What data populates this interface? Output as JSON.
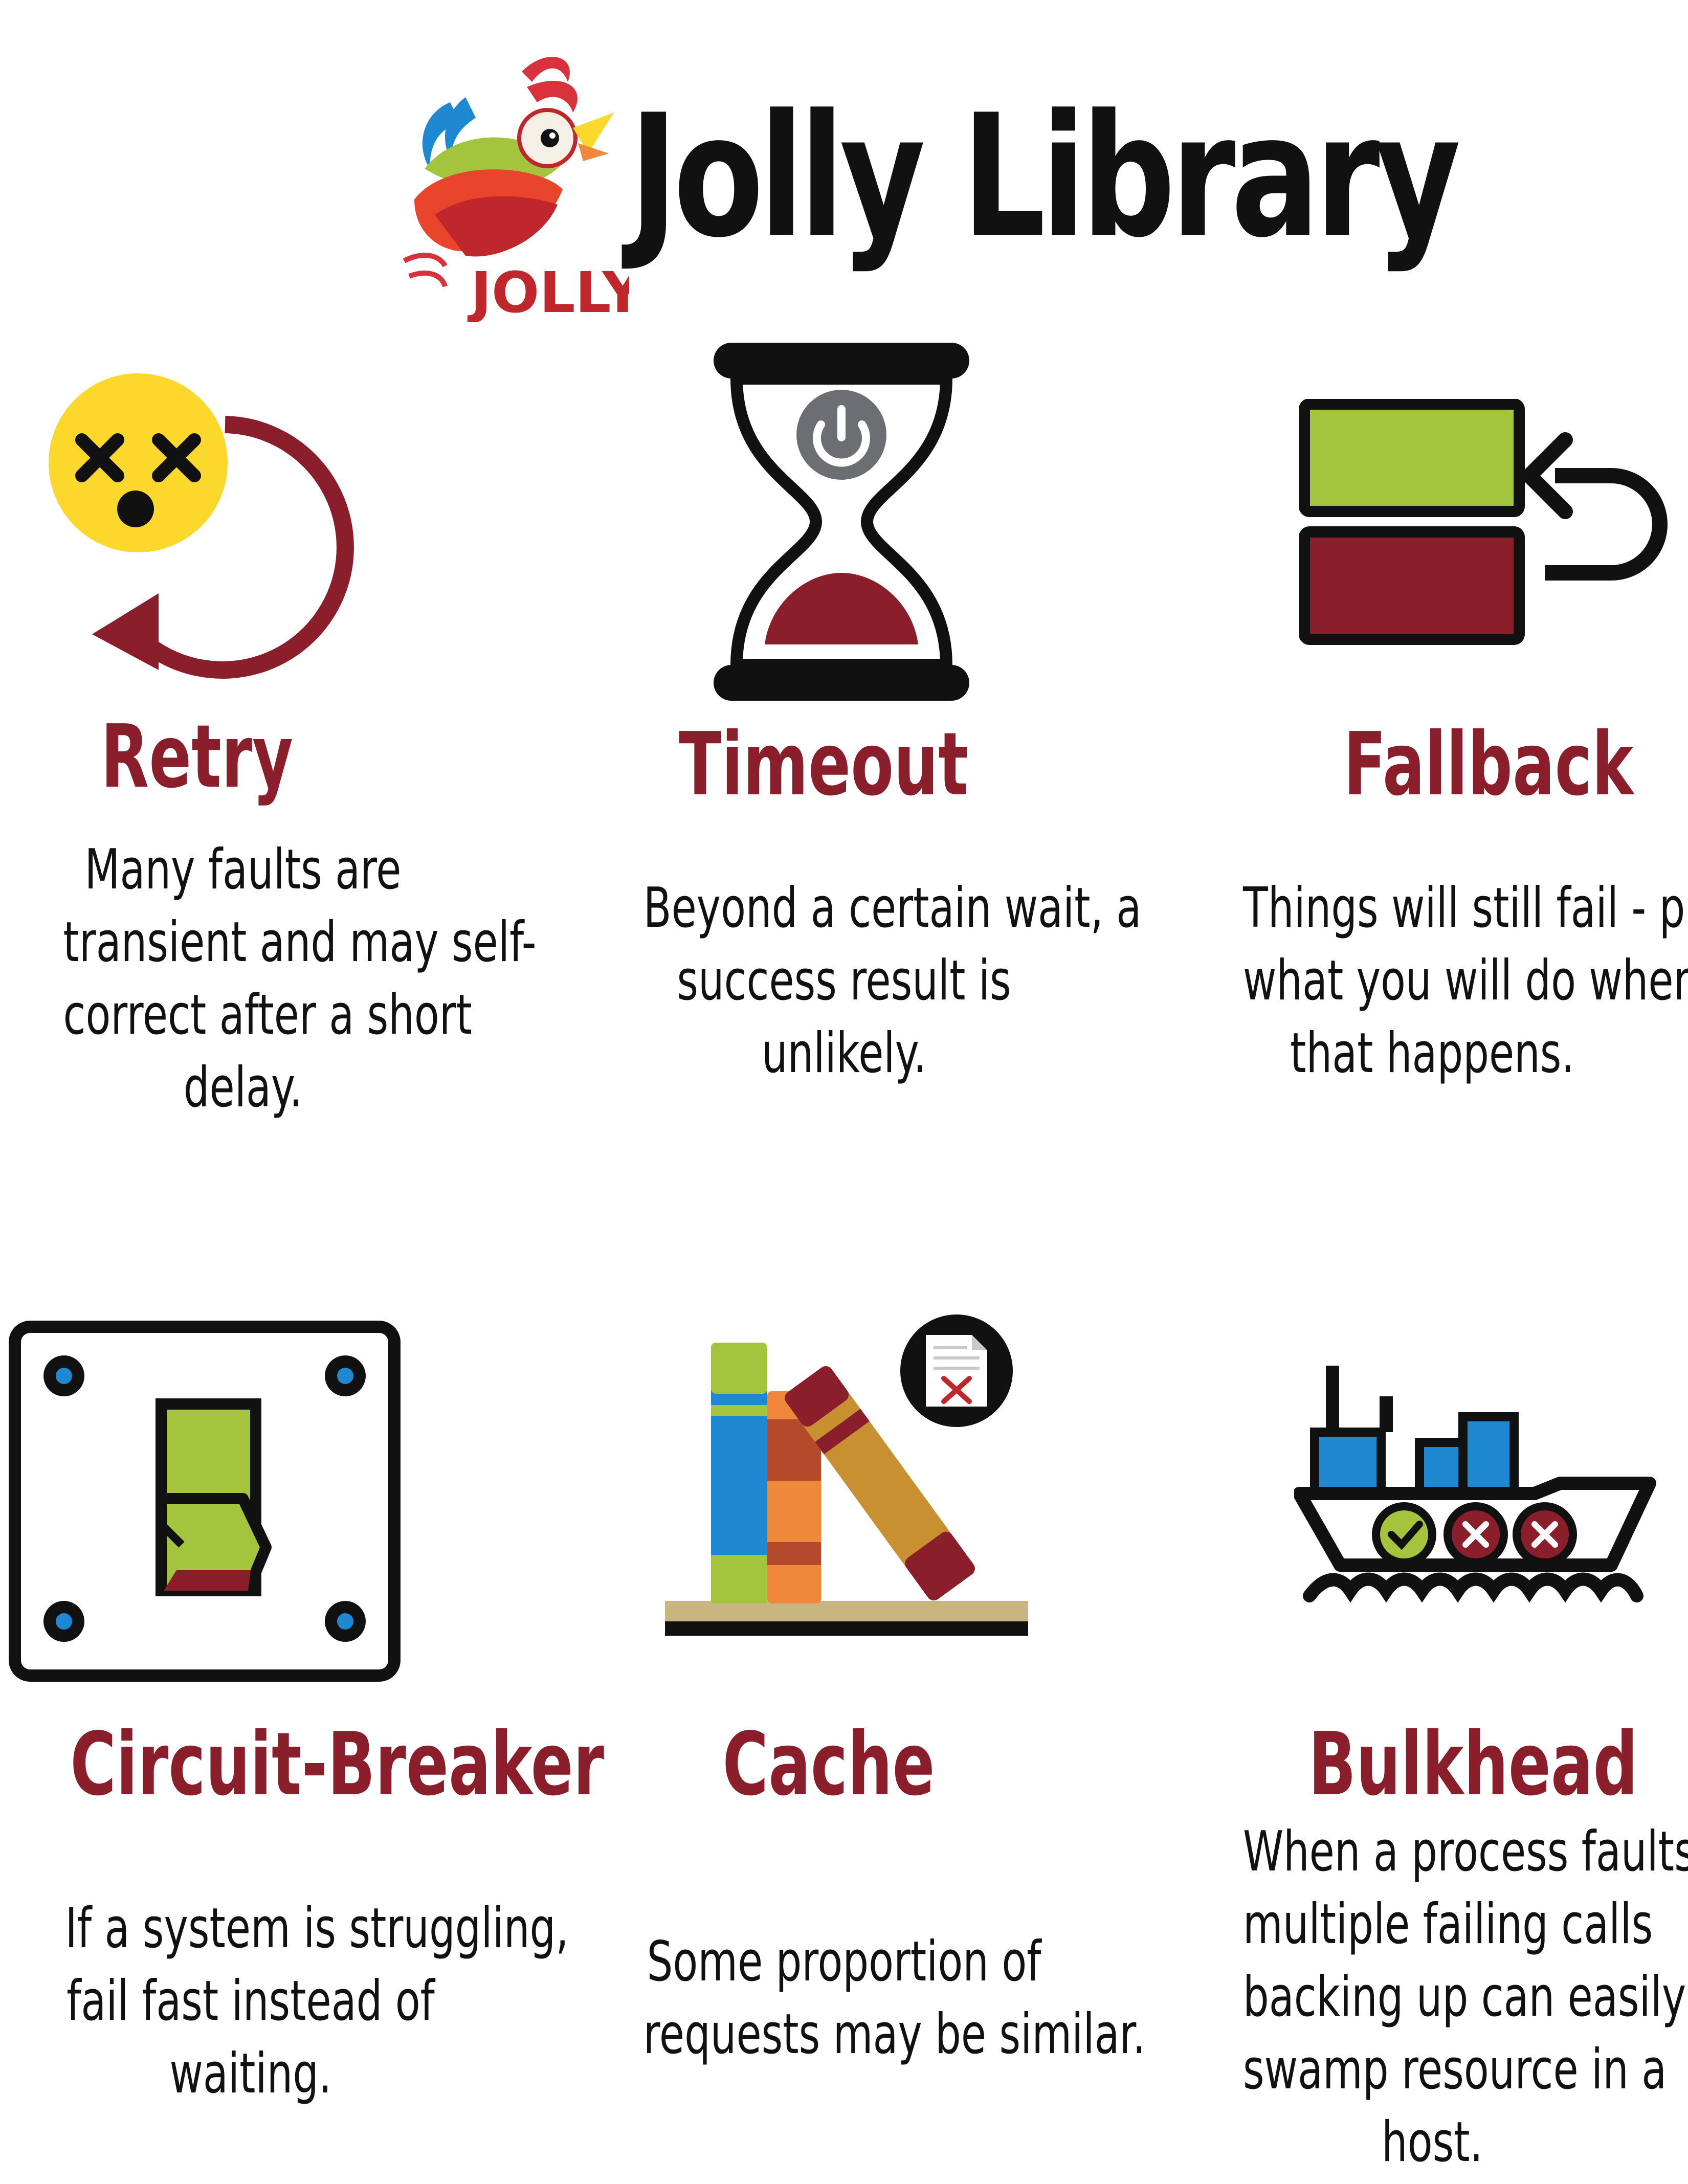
{
  "header": {
    "title": "Jolly Library",
    "logo": {
      "icon": "jolly-parrot-logo-icon",
      "wordmark": "JOLLY"
    }
  },
  "colors": {
    "accent": "#8b1e2b",
    "green": "#a3c43c",
    "blue": "#1e88d2",
    "orange": "#f0883c",
    "yellow": "#fcd72c",
    "dark": "#111111"
  },
  "cards": [
    {
      "title": "Retry",
      "icon": "dizzy-face-retry-icon",
      "desc": [
        "Many faults are",
        "transient and may self-",
        "correct after a short",
        "delay."
      ]
    },
    {
      "title": "Timeout",
      "icon": "hourglass-icon",
      "desc": [
        "Beyond a certain wait, a",
        "success result is",
        "unlikely."
      ]
    },
    {
      "title": "Fallback",
      "icon": "fallback-blocks-icon",
      "desc": [
        "Things will still fail - plan",
        "what you will do when",
        "that happens."
      ]
    },
    {
      "title": "Circuit-Breaker",
      "icon": "circuit-switch-icon",
      "desc": [
        "If a system is struggling,",
        "fail fast instead of",
        "waiting."
      ]
    },
    {
      "title": "Cache",
      "icon": "books-shelf-icon",
      "desc": [
        "Some proportion of",
        "requests may be similar."
      ]
    },
    {
      "title": "Bulkhead",
      "icon": "ship-bulkhead-icon",
      "desc": [
        "When a process faults,",
        "multiple failing calls",
        "backing up can easily",
        "swamp resource in a",
        "host."
      ]
    }
  ]
}
